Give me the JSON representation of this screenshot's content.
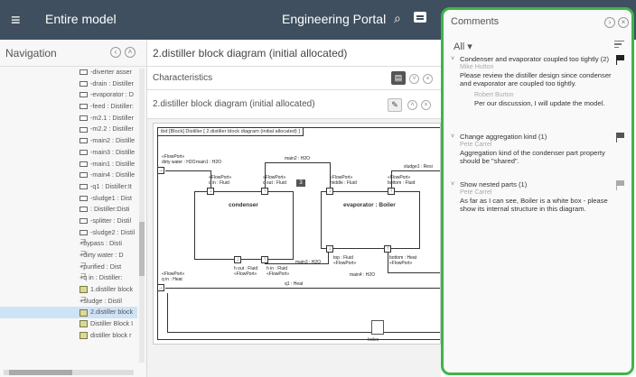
{
  "header": {
    "model_title": "Entire model",
    "portal_title": "Engineering Portal"
  },
  "nav": {
    "title": "Navigation",
    "items": [
      {
        "label": "-diverter asser",
        "icon": "part"
      },
      {
        "label": "-drain : Distiller",
        "icon": "part"
      },
      {
        "label": "-evaporator : D",
        "icon": "part"
      },
      {
        "label": "-feed : Distiller:",
        "icon": "part"
      },
      {
        "label": "-m2.1 : Distiller",
        "icon": "part"
      },
      {
        "label": "-m2.2 : Distiller",
        "icon": "part"
      },
      {
        "label": "-main2 : Distille",
        "icon": "part"
      },
      {
        "label": "-main3 : Distille",
        "icon": "part"
      },
      {
        "label": "-main1 : Distille",
        "icon": "part"
      },
      {
        "label": "-main4 : Distille",
        "icon": "part"
      },
      {
        "label": "-q1 : Distiller:It",
        "icon": "part"
      },
      {
        "label": "-sludge1 : Dist",
        "icon": "part"
      },
      {
        "label": ": Distiller:Disti",
        "icon": "part"
      },
      {
        "label": "-splitter : Distil",
        "icon": "part"
      },
      {
        "label": "-sludge2 : Distil",
        "icon": "part"
      },
      {
        "label": "+bypass : Disti",
        "icon": "port"
      },
      {
        "label": "+dirty water : D",
        "icon": "port"
      },
      {
        "label": "+purified : Dist",
        "icon": "port"
      },
      {
        "label": "+q in : Distiller:",
        "icon": "port"
      },
      {
        "label": "1.distiller block",
        "icon": "diagram"
      },
      {
        "label": "+sludge : Distil",
        "icon": "port"
      },
      {
        "label": "2.distiller block",
        "icon": "diagram",
        "selected": true
      },
      {
        "label": "Distiller Block I",
        "icon": "diagram"
      },
      {
        "label": "distiller block r",
        "icon": "diagram"
      }
    ]
  },
  "main": {
    "title": "2.distiller block diagram (initial allocated)",
    "characteristics": "Characteristics",
    "diagram_section": "2.distiller block diagram (initial allocated)",
    "diagram": {
      "frame_title": "ibd [Block] Distiller [ 2.distiller block diagram (initial allocated) ]",
      "labels": {
        "flowport_dirty": "«FlowPort»",
        "dirty_water": "dirty water : H2O",
        "main1": "main1 : H2O",
        "main2": "main2 : H2O",
        "sludge1": "sludge1 : Resi",
        "c_in_stereo": "«FlowPort»",
        "c_in": "c in : Fluid",
        "c_out_stereo": "«FlowPort»",
        "c_out": "c out : Fluid",
        "middle_stereo": "«FlowPort»",
        "middle": "middle : Fluid",
        "bottom_stereo": "«FlowPort»",
        "bottom": "bottom : Fluid",
        "condenser": "condenser",
        "evaporator": "evaporator : Boiler",
        "badge": "3",
        "top": "top : Fluid",
        "top_stereo": "«FlowPort»",
        "bottom_heat": "bottom : Heat",
        "bottom_heat_stereo": "«FlowPort»",
        "main3": "main3 : H2O",
        "main4": "main4 : H2O",
        "h_out": "h out : Fluid",
        "h_out_stereo": "«FlowPort»",
        "h_in": "h in : Fluid",
        "h_in_stereo": "«FlowPort»",
        "q1": "q1 : Heat",
        "q_in_stereo": "«FlowPort»",
        "q_in": "q in : Heat",
        "index": "Index"
      }
    }
  },
  "comments": {
    "title": "Comments",
    "filter": "All",
    "threads": [
      {
        "title": "Condenser and evaporator coupled too tightly (2)",
        "author": "Mike Hutton",
        "body": "Please review the distiller design since condenser and evaporator are coupled too tightly.",
        "reply_author": "Robert Burton",
        "reply_body": "Per our discussion, I will update the model.",
        "flag_color": "#222222"
      },
      {
        "title": "Change aggregation kind (1)",
        "author": "Pete Carrel",
        "body": "Aggregation kind of the condenser part property should be \"shared\".",
        "flag_color": "#555555"
      },
      {
        "title": "Show nested parts (1)",
        "author": "Pete Carrel",
        "body": "As far as I can see, Boiler is a white box - please show its internal structure in this diagram.",
        "flag_color": "#aaaaaa"
      }
    ]
  },
  "colors": {
    "header_bg": "#3f4f5f",
    "highlight_border": "#3db54a",
    "selected_bg": "#cfe3f6"
  }
}
